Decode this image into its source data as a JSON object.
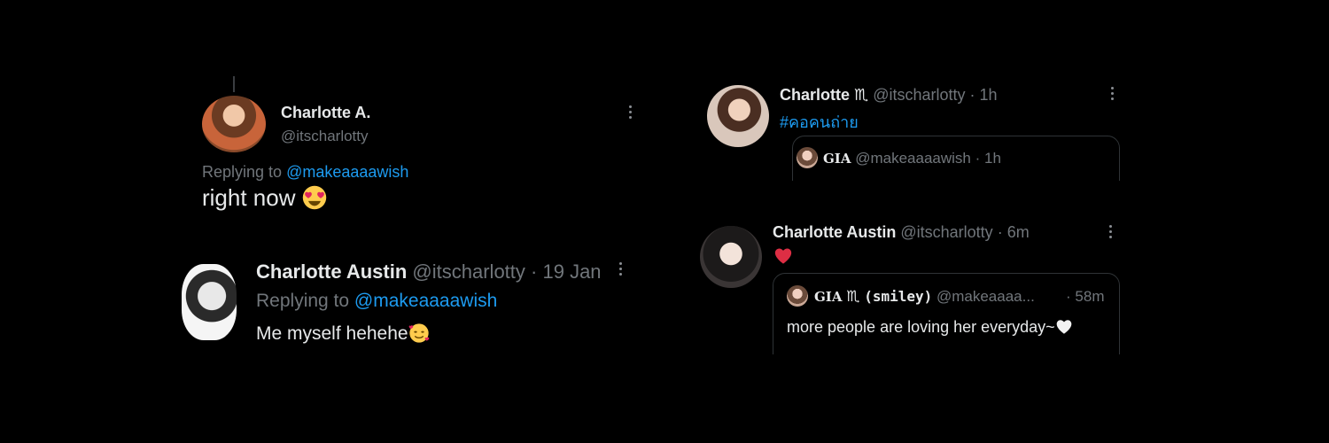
{
  "tweet1": {
    "display_name": "Charlotte A.",
    "handle": "@itscharlotty",
    "replying_prefix": "Replying to",
    "replying_to": "@makeaaaawish",
    "text": "right now",
    "emoji_icon": "smiling-face-with-heart-eyes-icon"
  },
  "tweet2": {
    "display_name": "Charlotte Austin",
    "handle": "@itscharlotty",
    "separator": "·",
    "time": "19 Jan",
    "replying_prefix": "Replying to",
    "replying_to": "@makeaaaawish",
    "text": "Me myself hehehe",
    "emoji_icon": "smiling-face-with-hearts-icon"
  },
  "tweet3": {
    "display_name": "Charlotte",
    "name_symbol": "♏",
    "handle": "@itscharlotty",
    "separator": "·",
    "time": "1h",
    "hashtag": "#คอคนถ่าย",
    "quote": {
      "display_name": "GIA",
      "handle": "@makeaaaawish",
      "separator": "·",
      "time": "1h"
    }
  },
  "tweet4": {
    "display_name": "Charlotte Austin",
    "handle": "@itscharlotty",
    "separator": "·",
    "time": "6m",
    "emoji_icon": "red-heart-icon",
    "quote": {
      "display_name": "GIA",
      "name_symbol": "♏",
      "name_suffix": "(smiley)",
      "handle": "@makeaaaa...",
      "separator": "·",
      "time": "58m",
      "text": "more people are loving her everyday~",
      "emoji_icon": "white-heart-icon"
    }
  },
  "colors": {
    "background": "#000000",
    "text": "#e7e9ea",
    "muted": "#71767b",
    "link": "#1d9bf0",
    "border": "#2f3336"
  }
}
